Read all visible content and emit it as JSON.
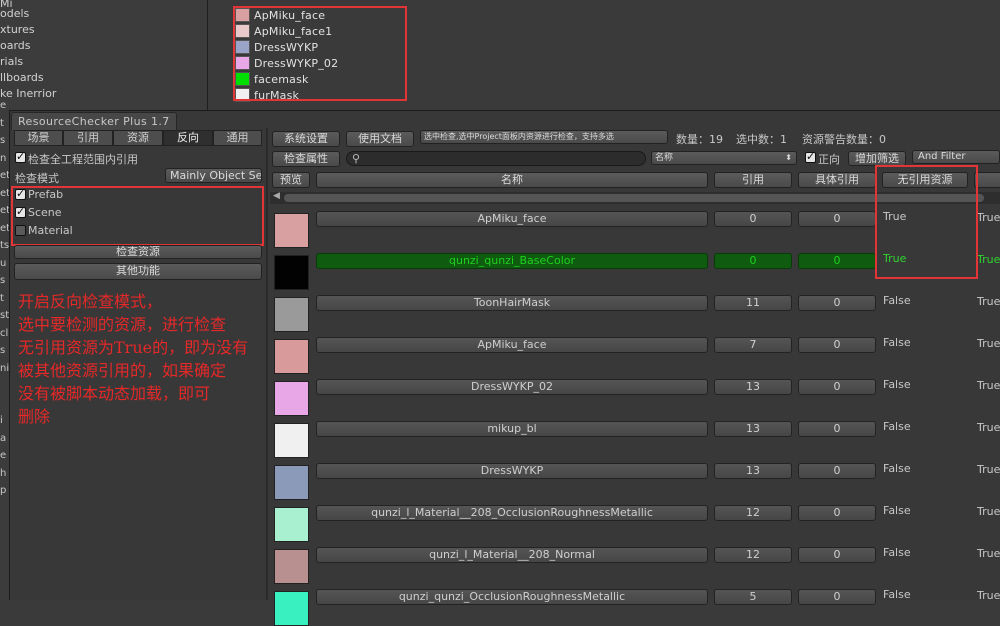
{
  "background": {
    "left_items": [
      "Mi",
      "odels",
      "xtures",
      "oards",
      "rials",
      "llboards",
      "ke Inerrior"
    ],
    "assets": [
      {
        "name": "ApMiku_face",
        "thumb": "#d8a0a0"
      },
      {
        "name": "ApMiku_face1",
        "thumb": "#e8c8c8"
      },
      {
        "name": "DressWYKP",
        "thumb": "#9aa4c8"
      },
      {
        "name": "DressWYKP_02",
        "thumb": "#e8a8e8"
      },
      {
        "name": "facemask",
        "thumb": "#00e000"
      },
      {
        "name": "furMask",
        "thumb": "#f0f0f0"
      }
    ],
    "side_letters": [
      "e",
      "t",
      "s",
      "n",
      "et",
      "et",
      "et",
      "et",
      "ts",
      "u",
      "s",
      "t",
      "st",
      "cl",
      "s",
      "ni",
      "",
      "",
      "i",
      "a",
      "e",
      "h",
      "p"
    ]
  },
  "window": {
    "title": "ResourceChecker Plus 1.7"
  },
  "left_panel": {
    "tabs": [
      "场景",
      "引用",
      "资源",
      "反向",
      "通用"
    ],
    "active_tab": 3,
    "scope_label": "检查全工程范围内引用",
    "mode_label": "检查模式",
    "mode_value": "Mainly Object S⸮e",
    "mode_value_display": "Mainly Object Se",
    "options": [
      {
        "label": "Prefab",
        "checked": true
      },
      {
        "label": "Scene",
        "checked": true
      },
      {
        "label": "Material",
        "checked": false
      }
    ],
    "check_button": "检查资源",
    "other_button": "其他功能"
  },
  "annotation": "开启反向检查模式，\n选中要检测的资源，进行检查\n无引用资源为True的，即为没有\n被其他资源引用的，如果确定\n没有被脚本动态加载，即可\n删除",
  "toolbar": {
    "settings_button": "系统设置",
    "docs_button": "使用文档",
    "hint": "选中检查,选中Project面板内资源进行检查，支持多选",
    "count_text": "数量：19",
    "selected_text": "选中数：1",
    "warning_text": "资源警告数量：0",
    "check_attr_button": "检查属性",
    "search_placeholder": "",
    "sort_field": "名称",
    "ascending_label": "正向",
    "ascending_checked": true,
    "add_filter_button": "增加筛选",
    "and_filter_button": "And Filter"
  },
  "table": {
    "headers": {
      "preview": "预览",
      "name": "名称",
      "ref": "引用",
      "detail_ref": "具体引用",
      "unreferenced": "无引用资源"
    },
    "rows": [
      {
        "name": "ApMiku_face",
        "ref": "0",
        "detail": "0",
        "unref": "True",
        "unref2": "True",
        "thumb": "#d8a0a0",
        "highlight": false
      },
      {
        "name": "qunzi_qunzi_BaseColor",
        "ref": "0",
        "detail": "0",
        "unref": "True",
        "unref2": "True",
        "thumb": "#020202",
        "highlight": true
      },
      {
        "name": "ToonHairMask",
        "ref": "11",
        "detail": "0",
        "unref": "False",
        "unref2": "True",
        "thumb": "#9a9a9a",
        "highlight": false
      },
      {
        "name": "ApMiku_face",
        "ref": "7",
        "detail": "0",
        "unref": "False",
        "unref2": "True",
        "thumb": "#d89a9a",
        "highlight": false
      },
      {
        "name": "DressWYKP_02",
        "ref": "13",
        "detail": "0",
        "unref": "False",
        "unref2": "True",
        "thumb": "#e8a8e8",
        "highlight": false
      },
      {
        "name": "mikup_bl",
        "ref": "13",
        "detail": "0",
        "unref": "False",
        "unref2": "True",
        "thumb": "#f0f0f0",
        "highlight": false
      },
      {
        "name": "DressWYKP",
        "ref": "13",
        "detail": "0",
        "unref": "False",
        "unref2": "True",
        "thumb": "#8a9ab8",
        "highlight": false
      },
      {
        "name": "qunzi_l_Material__208_OcclusionRoughnessMetallic",
        "ref": "12",
        "detail": "0",
        "unref": "False",
        "unref2": "True",
        "thumb": "#a8f0d0",
        "highlight": false
      },
      {
        "name": "qunzi_l_Material__208_Normal",
        "ref": "12",
        "detail": "0",
        "unref": "False",
        "unref2": "True",
        "thumb": "#b89090",
        "highlight": false
      },
      {
        "name": "qunzi_qunzi_OcclusionRoughnessMetallic",
        "ref": "5",
        "detail": "0",
        "unref": "False",
        "unref2": "True",
        "thumb": "#38f0c0",
        "highlight": false
      }
    ]
  },
  "colors": {
    "highlight_red": "#e23636",
    "true_green": "#2ed62e",
    "row_green_bg": "#0f5b0f"
  }
}
